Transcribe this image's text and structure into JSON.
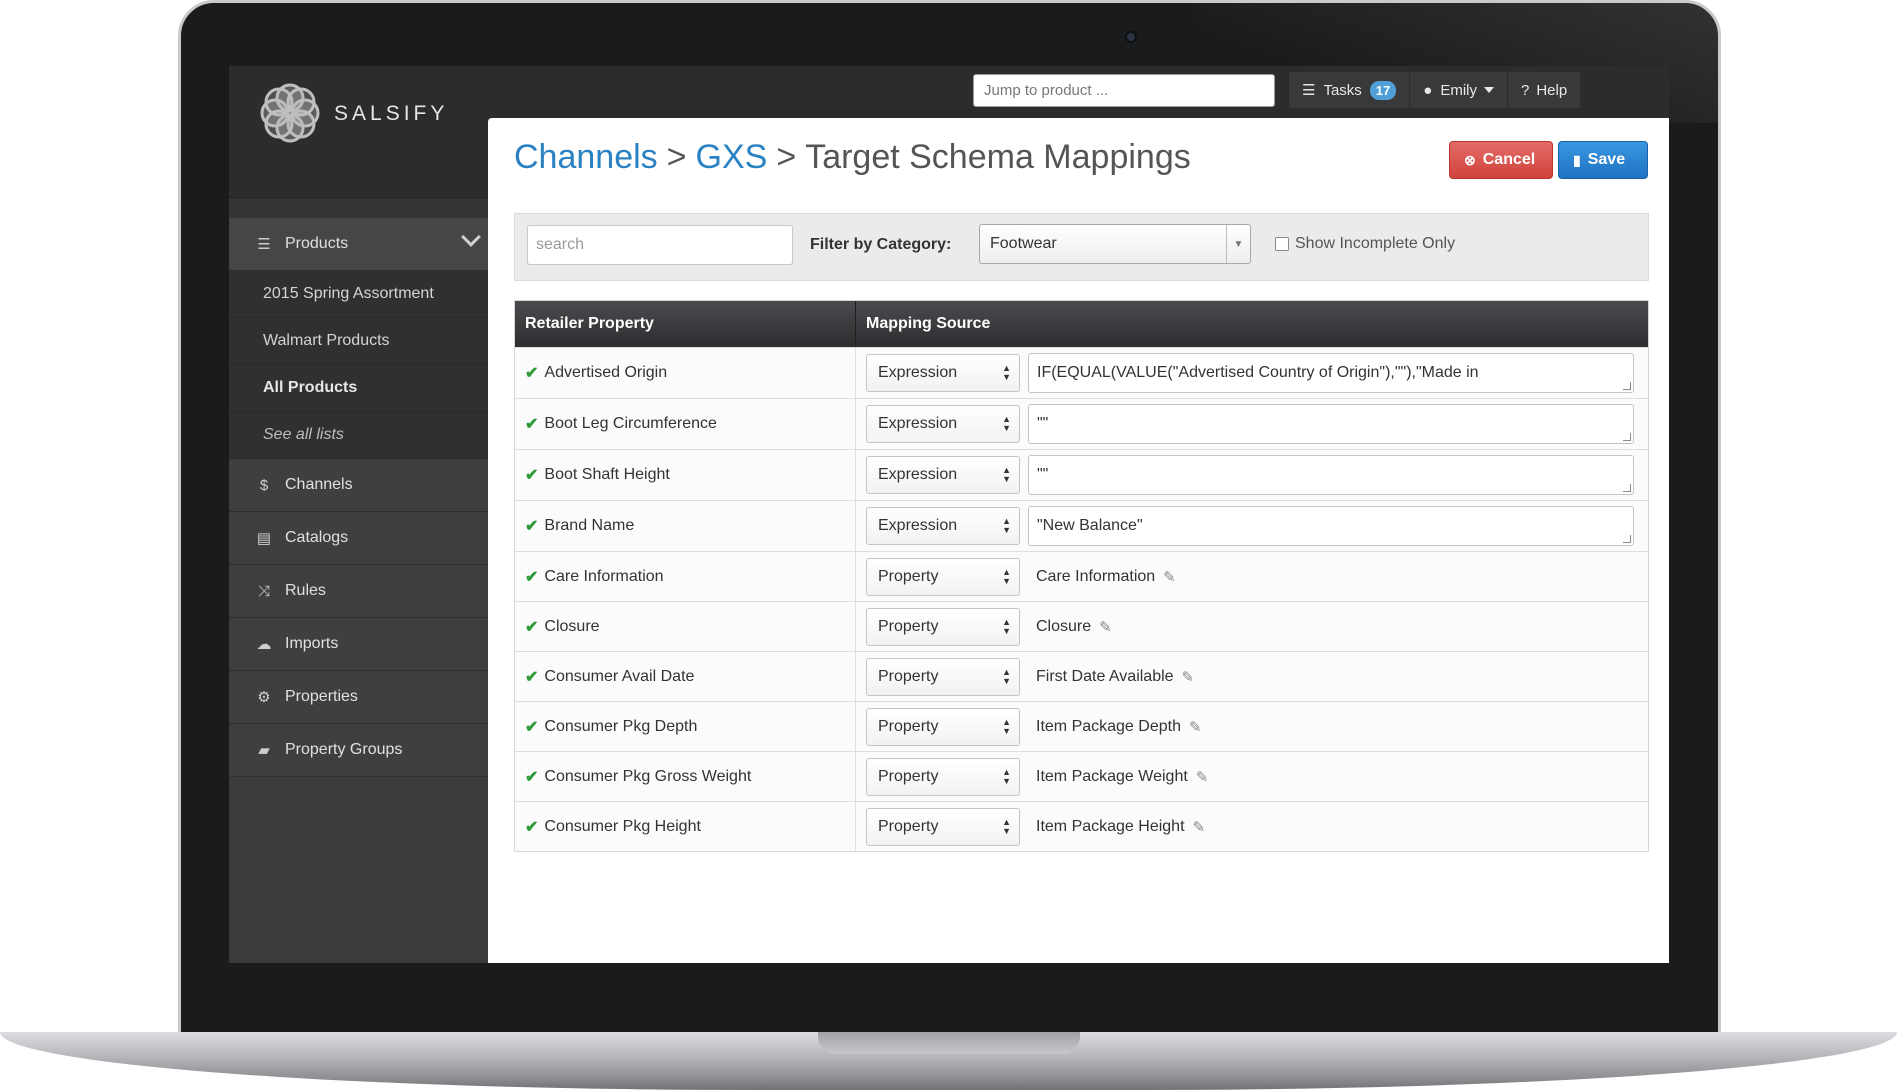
{
  "app": {
    "logo_text": "SALSIFY"
  },
  "topbar": {
    "jump_placeholder": "Jump to product ...",
    "tasks_label": "Tasks",
    "tasks_count": "17",
    "user_label": "Emily",
    "help_label": "Help"
  },
  "sidebar": {
    "products_label": "Products",
    "sub_items": [
      "2015 Spring Assortment",
      "Walmart Products",
      "All Products",
      "See all lists"
    ],
    "items": [
      "Channels",
      "Catalogs",
      "Rules",
      "Imports",
      "Properties",
      "Property Groups"
    ]
  },
  "header": {
    "crumb1": "Channels",
    "sep": ">",
    "crumb2": "GXS",
    "title": "Target Schema Mappings",
    "cancel_label": "Cancel",
    "save_label": "Save"
  },
  "filter": {
    "search_placeholder": "search",
    "category_label": "Filter by Category:",
    "category_value": "Footwear",
    "incomplete_label": "Show Incomplete Only"
  },
  "table": {
    "col1": "Retailer Property",
    "col2": "Mapping Source",
    "rows": [
      {
        "property": "Advertised Origin",
        "source": "Expression",
        "value": "IF(EQUAL(VALUE(\"Advertised Country of Origin\"),\"\"),\"Made in"
      },
      {
        "property": "Boot Leg Circumference",
        "source": "Expression",
        "value": "\"\""
      },
      {
        "property": "Boot Shaft Height",
        "source": "Expression",
        "value": "\"\""
      },
      {
        "property": "Brand Name",
        "source": "Expression",
        "value": "\"New Balance\""
      },
      {
        "property": "Care Information",
        "source": "Property",
        "value": "Care Information"
      },
      {
        "property": "Closure",
        "source": "Property",
        "value": "Closure"
      },
      {
        "property": "Consumer Avail Date",
        "source": "Property",
        "value": "First Date Available"
      },
      {
        "property": "Consumer Pkg Depth",
        "source": "Property",
        "value": "Item Package Depth"
      },
      {
        "property": "Consumer Pkg Gross Weight",
        "source": "Property",
        "value": "Item Package Weight"
      },
      {
        "property": "Consumer Pkg Height",
        "source": "Property",
        "value": "Item Package Height"
      }
    ]
  }
}
